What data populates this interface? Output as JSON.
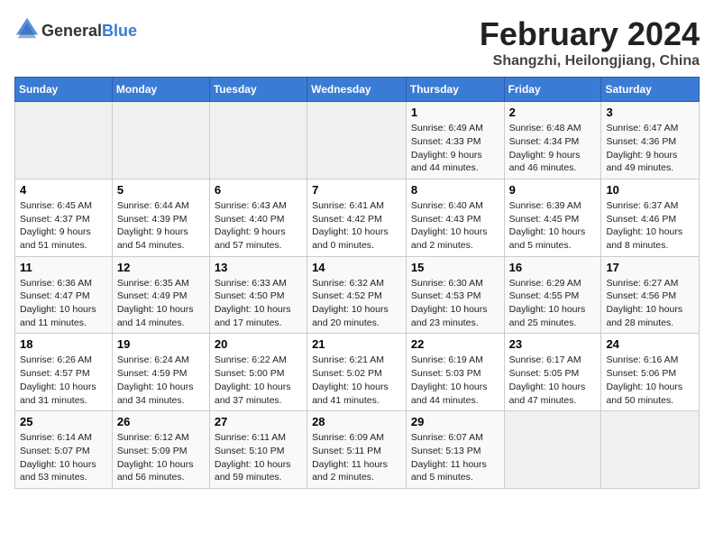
{
  "header": {
    "logo_line1": "General",
    "logo_line2": "Blue",
    "month_year": "February 2024",
    "location": "Shangzhi, Heilongjiang, China"
  },
  "weekdays": [
    "Sunday",
    "Monday",
    "Tuesday",
    "Wednesday",
    "Thursday",
    "Friday",
    "Saturday"
  ],
  "weeks": [
    [
      {
        "day": "",
        "info": ""
      },
      {
        "day": "",
        "info": ""
      },
      {
        "day": "",
        "info": ""
      },
      {
        "day": "",
        "info": ""
      },
      {
        "day": "1",
        "info": "Sunrise: 6:49 AM\nSunset: 4:33 PM\nDaylight: 9 hours\nand 44 minutes."
      },
      {
        "day": "2",
        "info": "Sunrise: 6:48 AM\nSunset: 4:34 PM\nDaylight: 9 hours\nand 46 minutes."
      },
      {
        "day": "3",
        "info": "Sunrise: 6:47 AM\nSunset: 4:36 PM\nDaylight: 9 hours\nand 49 minutes."
      }
    ],
    [
      {
        "day": "4",
        "info": "Sunrise: 6:45 AM\nSunset: 4:37 PM\nDaylight: 9 hours\nand 51 minutes."
      },
      {
        "day": "5",
        "info": "Sunrise: 6:44 AM\nSunset: 4:39 PM\nDaylight: 9 hours\nand 54 minutes."
      },
      {
        "day": "6",
        "info": "Sunrise: 6:43 AM\nSunset: 4:40 PM\nDaylight: 9 hours\nand 57 minutes."
      },
      {
        "day": "7",
        "info": "Sunrise: 6:41 AM\nSunset: 4:42 PM\nDaylight: 10 hours\nand 0 minutes."
      },
      {
        "day": "8",
        "info": "Sunrise: 6:40 AM\nSunset: 4:43 PM\nDaylight: 10 hours\nand 2 minutes."
      },
      {
        "day": "9",
        "info": "Sunrise: 6:39 AM\nSunset: 4:45 PM\nDaylight: 10 hours\nand 5 minutes."
      },
      {
        "day": "10",
        "info": "Sunrise: 6:37 AM\nSunset: 4:46 PM\nDaylight: 10 hours\nand 8 minutes."
      }
    ],
    [
      {
        "day": "11",
        "info": "Sunrise: 6:36 AM\nSunset: 4:47 PM\nDaylight: 10 hours\nand 11 minutes."
      },
      {
        "day": "12",
        "info": "Sunrise: 6:35 AM\nSunset: 4:49 PM\nDaylight: 10 hours\nand 14 minutes."
      },
      {
        "day": "13",
        "info": "Sunrise: 6:33 AM\nSunset: 4:50 PM\nDaylight: 10 hours\nand 17 minutes."
      },
      {
        "day": "14",
        "info": "Sunrise: 6:32 AM\nSunset: 4:52 PM\nDaylight: 10 hours\nand 20 minutes."
      },
      {
        "day": "15",
        "info": "Sunrise: 6:30 AM\nSunset: 4:53 PM\nDaylight: 10 hours\nand 23 minutes."
      },
      {
        "day": "16",
        "info": "Sunrise: 6:29 AM\nSunset: 4:55 PM\nDaylight: 10 hours\nand 25 minutes."
      },
      {
        "day": "17",
        "info": "Sunrise: 6:27 AM\nSunset: 4:56 PM\nDaylight: 10 hours\nand 28 minutes."
      }
    ],
    [
      {
        "day": "18",
        "info": "Sunrise: 6:26 AM\nSunset: 4:57 PM\nDaylight: 10 hours\nand 31 minutes."
      },
      {
        "day": "19",
        "info": "Sunrise: 6:24 AM\nSunset: 4:59 PM\nDaylight: 10 hours\nand 34 minutes."
      },
      {
        "day": "20",
        "info": "Sunrise: 6:22 AM\nSunset: 5:00 PM\nDaylight: 10 hours\nand 37 minutes."
      },
      {
        "day": "21",
        "info": "Sunrise: 6:21 AM\nSunset: 5:02 PM\nDaylight: 10 hours\nand 41 minutes."
      },
      {
        "day": "22",
        "info": "Sunrise: 6:19 AM\nSunset: 5:03 PM\nDaylight: 10 hours\nand 44 minutes."
      },
      {
        "day": "23",
        "info": "Sunrise: 6:17 AM\nSunset: 5:05 PM\nDaylight: 10 hours\nand 47 minutes."
      },
      {
        "day": "24",
        "info": "Sunrise: 6:16 AM\nSunset: 5:06 PM\nDaylight: 10 hours\nand 50 minutes."
      }
    ],
    [
      {
        "day": "25",
        "info": "Sunrise: 6:14 AM\nSunset: 5:07 PM\nDaylight: 10 hours\nand 53 minutes."
      },
      {
        "day": "26",
        "info": "Sunrise: 6:12 AM\nSunset: 5:09 PM\nDaylight: 10 hours\nand 56 minutes."
      },
      {
        "day": "27",
        "info": "Sunrise: 6:11 AM\nSunset: 5:10 PM\nDaylight: 10 hours\nand 59 minutes."
      },
      {
        "day": "28",
        "info": "Sunrise: 6:09 AM\nSunset: 5:11 PM\nDaylight: 11 hours\nand 2 minutes."
      },
      {
        "day": "29",
        "info": "Sunrise: 6:07 AM\nSunset: 5:13 PM\nDaylight: 11 hours\nand 5 minutes."
      },
      {
        "day": "",
        "info": ""
      },
      {
        "day": "",
        "info": ""
      }
    ]
  ]
}
